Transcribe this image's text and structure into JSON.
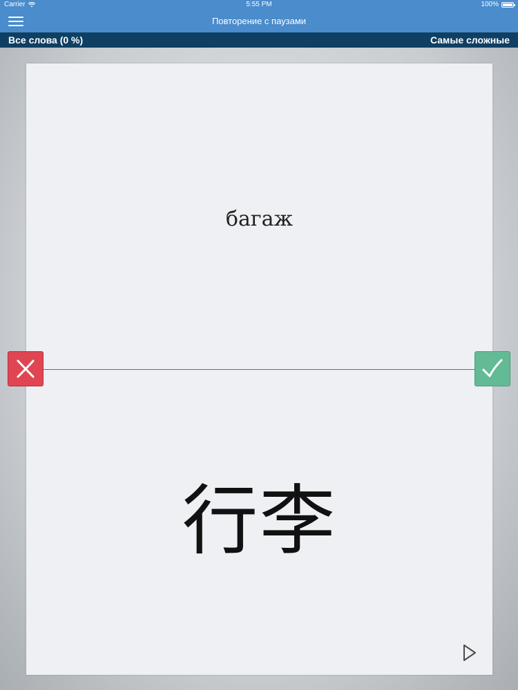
{
  "status_bar": {
    "carrier": "Carrier",
    "time": "5:55 PM",
    "battery": "100%"
  },
  "nav_bar": {
    "title": "Повторение с паузами",
    "menu_icon": "hamburger-menu-icon"
  },
  "sub_bar": {
    "left_label": "Все слова (0 %)",
    "right_label": "Самые сложные"
  },
  "card": {
    "word": "багаж",
    "answer": "行李"
  },
  "buttons": {
    "wrong_icon": "cross-icon",
    "correct_icon": "checkmark-icon",
    "play_icon": "play-icon"
  },
  "colors": {
    "header": "#4a8ccc",
    "sub_bar": "#0f3f63",
    "wrong": "#e04651",
    "correct": "#63bb96",
    "card": "#eef0f3"
  }
}
